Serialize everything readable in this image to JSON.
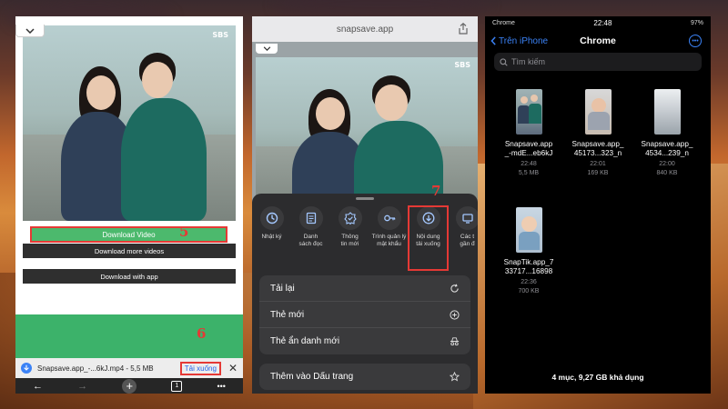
{
  "panel1": {
    "video_logo": "SBS",
    "download_video_label": "Download Video",
    "step5": "5",
    "download_more_label": "Download more videos",
    "download_app_label": "Download with app",
    "step6": "6",
    "download_bar": {
      "filename": "Snapsave.app_-...6kJ.mp4 - 5,5 MB",
      "action": "Tải xuống",
      "close": "✕"
    },
    "toolbar": {
      "back": "←",
      "forward": "→",
      "new_tab": "+",
      "tab_count": "1",
      "more": "•••"
    }
  },
  "panel2": {
    "url": "snapsave.app",
    "video_logo": "SBS",
    "step7": "7",
    "actions": [
      {
        "icon": "history-icon",
        "label": "Nhật ký"
      },
      {
        "icon": "reading-list-icon",
        "label": "Danh\nsách đọc"
      },
      {
        "icon": "news-icon",
        "label": "Thông\ntin mới"
      },
      {
        "icon": "password-key-icon",
        "label": "Trình quản lý\nmật khẩu"
      },
      {
        "icon": "download-icon",
        "label": "Nội dung\ntải xuống"
      },
      {
        "icon": "recent-tabs-icon",
        "label": "Các t\ngần đ"
      }
    ],
    "menu1": [
      {
        "label": "Tải lại",
        "icon": "reload-icon"
      },
      {
        "label": "Thẻ mới",
        "icon": "new-tab-icon"
      },
      {
        "label": "Thẻ ẩn danh mới",
        "icon": "incognito-icon"
      }
    ],
    "menu2": [
      {
        "label": "Thêm vào Dấu trang",
        "icon": "star-icon"
      }
    ]
  },
  "panel3": {
    "status": {
      "carrier": "Chrome",
      "time": "22:48",
      "battery": "97%"
    },
    "back_label": "Trên iPhone",
    "title": "Chrome",
    "search_placeholder": "Tìm kiếm",
    "files": [
      {
        "name": "Snapsave.app\n_-mdE...eb6kJ",
        "meta": "22:48\n5,5 MB"
      },
      {
        "name": "Snapsave.app_\n45173...323_n",
        "meta": "22:01\n169 KB"
      },
      {
        "name": "Snapsave.app_\n4534...239_n",
        "meta": "22:00\n840 KB"
      },
      {
        "name": "SnapTik.app_7\n33717...16898",
        "meta": "22:36\n700 KB"
      }
    ],
    "footer": "4 mục, 9,27 GB khả dụng"
  }
}
